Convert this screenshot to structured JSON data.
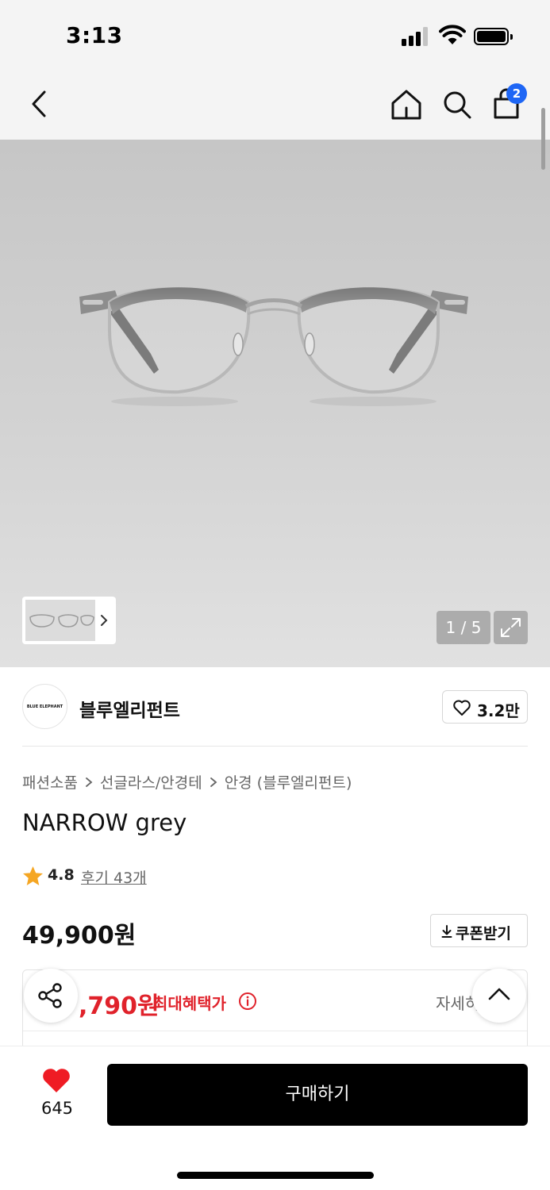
{
  "status_bar": {
    "time": "3:13"
  },
  "nav": {
    "cart_count": "2"
  },
  "gallery": {
    "page_indicator": "1 / 5"
  },
  "brand": {
    "logo_text": "BLUE ELEPHANT",
    "name": "블루엘리펀트",
    "like_count": "3.2만"
  },
  "breadcrumb": [
    "패션소품",
    "선글라스/안경테",
    "안경 (블루엘리펀트)"
  ],
  "product": {
    "title": "NARROW grey",
    "rating": "4.8",
    "review_link": "후기 43개",
    "price": "49,900원",
    "coupon_label": "쿠폰받기"
  },
  "benefit": {
    "price_partial": ",790원",
    "label": "최대혜택가",
    "detail_link_partial": "자세히"
  },
  "bottom_bar": {
    "wish_count": "645",
    "buy_label": "구매하기"
  },
  "colors": {
    "accent_red": "#e0222b",
    "badge_blue": "#1e66f5",
    "buy_button": "#000000"
  }
}
